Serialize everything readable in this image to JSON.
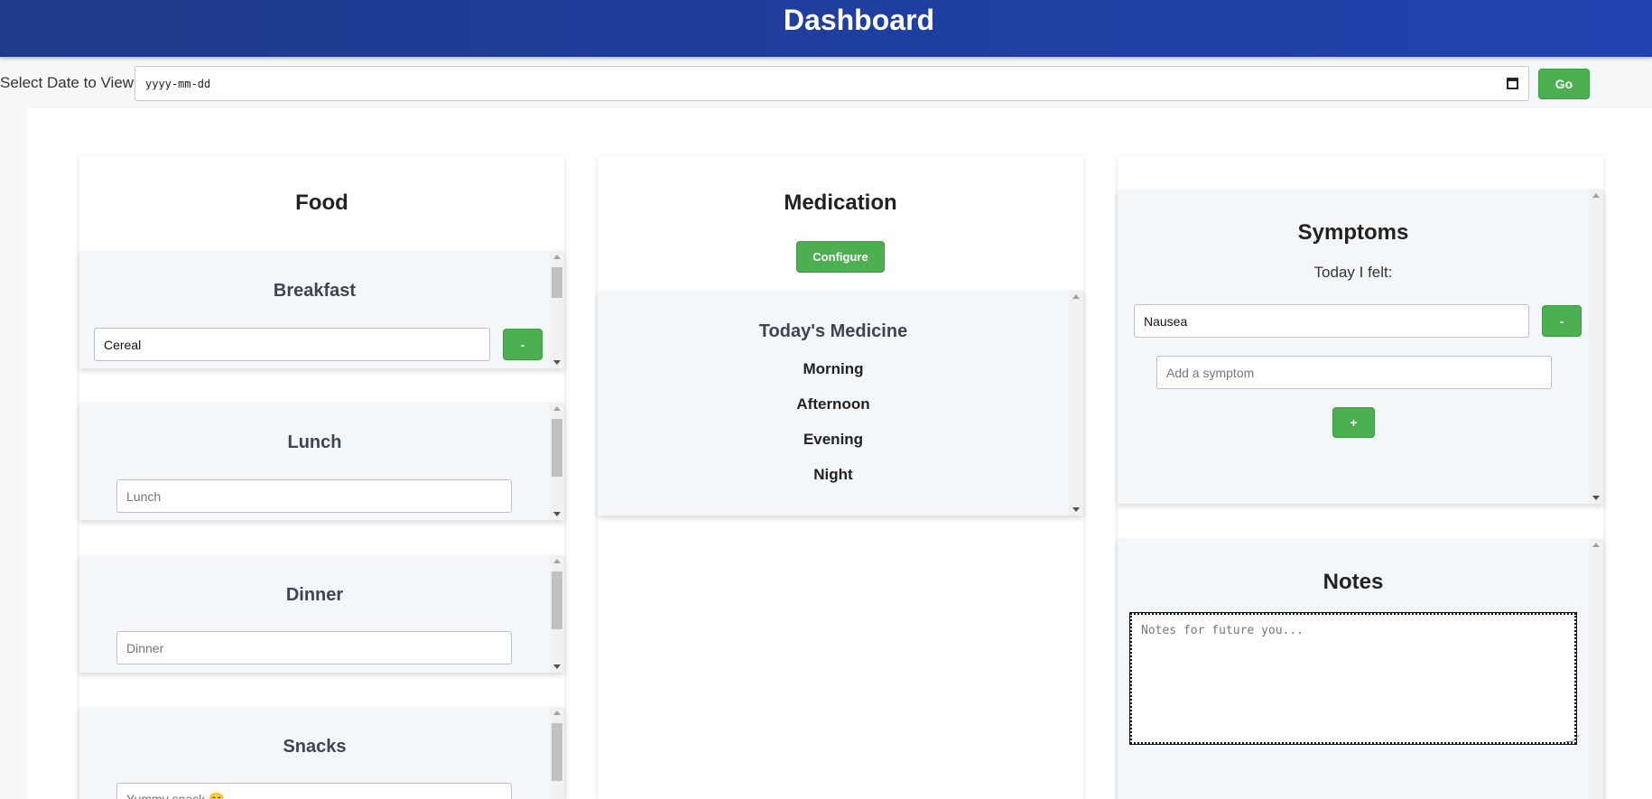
{
  "header": {
    "title": "Dashboard"
  },
  "date_bar": {
    "label": "Select Date to View",
    "placeholder": "yyyy-mm-dd",
    "go_label": "Go",
    "calendar_icon": "calendar-icon"
  },
  "food": {
    "title": "Food",
    "breakfast": {
      "title": "Breakfast",
      "items": [
        "Cereal"
      ],
      "remove_label": "-"
    },
    "lunch": {
      "title": "Lunch",
      "placeholder": "Lunch"
    },
    "dinner": {
      "title": "Dinner",
      "placeholder": "Dinner"
    },
    "snacks": {
      "title": "Snacks",
      "placeholder": "Yummy snack 😋"
    }
  },
  "medication": {
    "title": "Medication",
    "configure_label": "Configure",
    "today": {
      "title": "Today's Medicine",
      "times": [
        "Morning",
        "Afternoon",
        "Evening",
        "Night"
      ]
    }
  },
  "symptoms": {
    "title": "Symptoms",
    "prompt": "Today I felt:",
    "items": [
      "Nausea"
    ],
    "remove_label": "-",
    "add_placeholder": "Add a symptom",
    "add_label": "+"
  },
  "notes": {
    "title": "Notes",
    "placeholder": "Notes for future you..."
  },
  "colors": {
    "header": "#1e3a8a",
    "button": "#4caf50",
    "panel": "#f4f7fa"
  }
}
